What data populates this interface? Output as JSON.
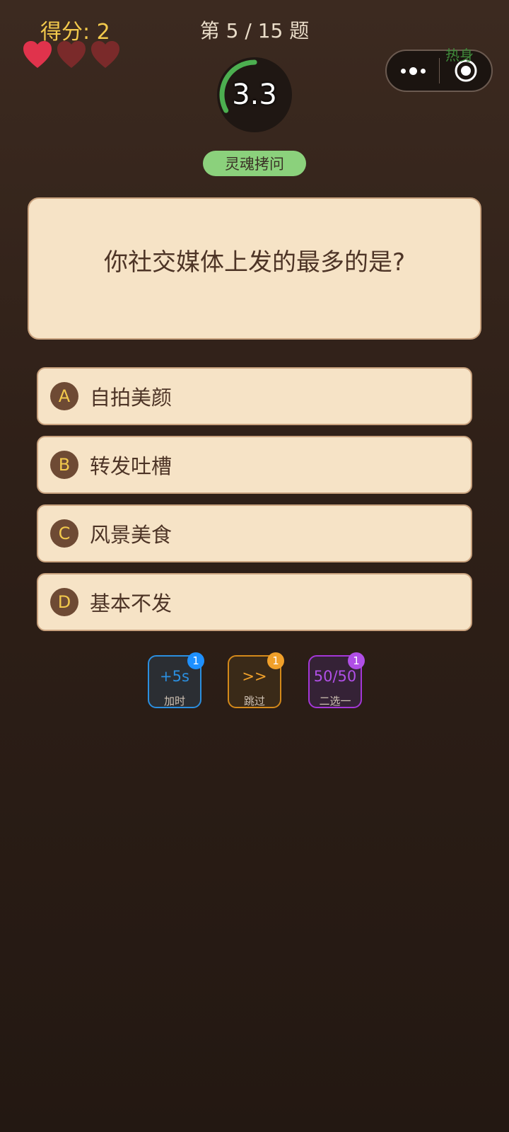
{
  "header": {
    "score_text": "得分: 2",
    "progress_text": "第 5 / 15 题",
    "lives": {
      "total": 3,
      "remaining": 1
    },
    "mode_tag": "热身"
  },
  "timer": {
    "value_text": "3.3",
    "remaining_fraction": 0.33,
    "ring_color": "#4caf50"
  },
  "category": {
    "label": "灵魂拷问"
  },
  "question": {
    "text": "你社交媒体上发的最多的是?"
  },
  "options": [
    {
      "letter": "A",
      "label": "自拍美颜"
    },
    {
      "letter": "B",
      "label": "转发吐槽"
    },
    {
      "letter": "C",
      "label": "风景美食"
    },
    {
      "letter": "D",
      "label": "基本不发"
    }
  ],
  "powerups": [
    {
      "main": "+5s",
      "sub": "加时",
      "count": "1",
      "color": "#2b8fe0"
    },
    {
      "main": ">>",
      "sub": "跳过",
      "count": "1",
      "color": "#f0a02a"
    },
    {
      "main": "50/50",
      "sub": "二选一",
      "count": "1",
      "color": "#b04fe6"
    }
  ],
  "icons": {
    "hearts": "heart-icon",
    "capsule_more": "more-dots-icon",
    "capsule_close": "target-icon"
  },
  "colors": {
    "heart_active": "#e0334c",
    "heart_lost": "#7a2a2a",
    "score": "#f2c94c",
    "card_bg": "#f6e3c6"
  }
}
